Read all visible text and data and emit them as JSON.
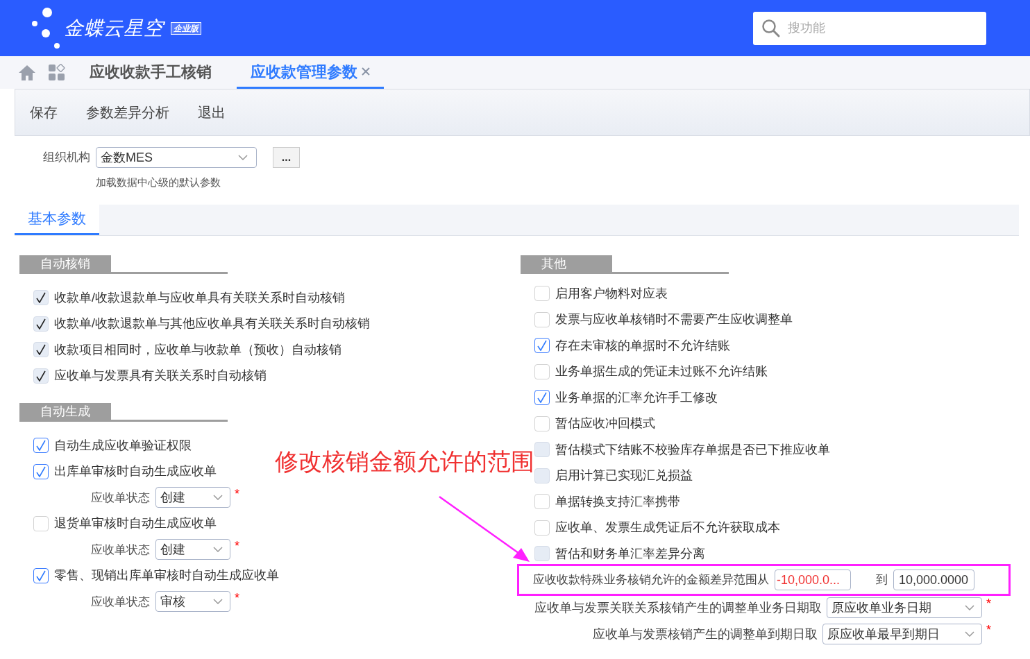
{
  "header": {
    "logo_text": "金蝶云星空",
    "edition_badge": "企业版",
    "search": {
      "placeholder": "搜功能"
    }
  },
  "tabs": [
    {
      "label": "应收收款手工核销",
      "selected": false,
      "closable": false
    },
    {
      "label": "应收款管理参数",
      "selected": true,
      "closable": true
    }
  ],
  "toolbar": [
    "保存",
    "参数差异分析",
    "退出"
  ],
  "org": {
    "label": "组织机构",
    "value": "金数MES",
    "more_button": "...",
    "hint": "加载数据中心级的默认参数"
  },
  "param_tabs": [
    {
      "label": "基本参数",
      "selected": true
    }
  ],
  "left_sections": [
    {
      "title": "自动核销",
      "items": [
        {
          "kind": "checkbox",
          "label": "收款单/收款退款单与应收单具有关联关系时自动核销",
          "checked": true,
          "disabled": true
        },
        {
          "kind": "checkbox",
          "label": "收款单/收款退款单与其他应收单具有关联关系时自动核销",
          "checked": true,
          "disabled": true
        },
        {
          "kind": "checkbox",
          "label": "收款项目相同时，应收单与收款单（预收）自动核销",
          "checked": true,
          "disabled": true
        },
        {
          "kind": "checkbox",
          "label": "应收单与发票具有关联关系时自动核销",
          "checked": true,
          "disabled": true
        }
      ]
    },
    {
      "title": "自动生成",
      "items": [
        {
          "kind": "checkbox",
          "label": "自动生成应收单验证权限",
          "checked": true,
          "disabled": false
        },
        {
          "kind": "checkbox",
          "label": "出库单审核时自动生成应收单",
          "checked": true,
          "disabled": false
        },
        {
          "kind": "select",
          "label": "应收单状态",
          "value": "创建",
          "required_mark": "*"
        },
        {
          "kind": "checkbox",
          "label": "退货单审核时自动生成应收单",
          "checked": false,
          "disabled": false
        },
        {
          "kind": "select",
          "label": "应收单状态",
          "value": "创建",
          "required_mark": "*"
        },
        {
          "kind": "checkbox",
          "label": "零售、现销出库单审核时自动生成应收单",
          "checked": true,
          "disabled": false
        },
        {
          "kind": "select",
          "label": "应收单状态",
          "value": "审核",
          "required_mark": "*"
        }
      ]
    }
  ],
  "right_section": {
    "title": "其他",
    "items": [
      {
        "kind": "checkbox",
        "label": "启用客户物料对应表",
        "checked": false,
        "disabled": false
      },
      {
        "kind": "checkbox",
        "label": "发票与应收单核销时不需要产生应收调整单",
        "checked": false,
        "disabled": false
      },
      {
        "kind": "checkbox",
        "label": "存在未审核的单据时不允许结账",
        "checked": true,
        "disabled": false
      },
      {
        "kind": "checkbox",
        "label": "业务单据生成的凭证未过账不允许结账",
        "checked": false,
        "disabled": false
      },
      {
        "kind": "checkbox",
        "label": "业务单据的汇率允许手工修改",
        "checked": true,
        "disabled": false
      },
      {
        "kind": "checkbox",
        "label": "暂估应收冲回模式",
        "checked": false,
        "disabled": false
      },
      {
        "kind": "checkbox",
        "label": "暂估模式下结账不校验库存单据是否已下推应收单",
        "checked": false,
        "disabled": true
      },
      {
        "kind": "checkbox",
        "label": "启用计算已实现汇兑损益",
        "checked": false,
        "disabled": true
      },
      {
        "kind": "checkbox",
        "label": "单据转换支持汇率携带",
        "checked": false,
        "disabled": false
      },
      {
        "kind": "checkbox",
        "label": "应收单、发票生成凭证后不允许获取成本",
        "checked": false,
        "disabled": false
      },
      {
        "kind": "checkbox",
        "label": "暂估和财务单汇率差异分离",
        "checked": false,
        "disabled": true
      }
    ]
  },
  "amount_range": {
    "label": "应收收款特殊业务核销允许的金额差异范围从",
    "from": "-10,000.0...",
    "to_label": "到",
    "to": "10,000.0000",
    "highlighted": true
  },
  "date_selects": [
    {
      "label": "应收单与发票关联关系核销产生的调整单业务日期取",
      "value": "原应收单业务日期",
      "required_mark": "*"
    },
    {
      "label": "应收单与发票核销产生的调整单到期日取",
      "value": "原应收单最早到期日",
      "required_mark": "*"
    }
  ],
  "annotation": {
    "text": "修改核销金额允许的范围"
  }
}
